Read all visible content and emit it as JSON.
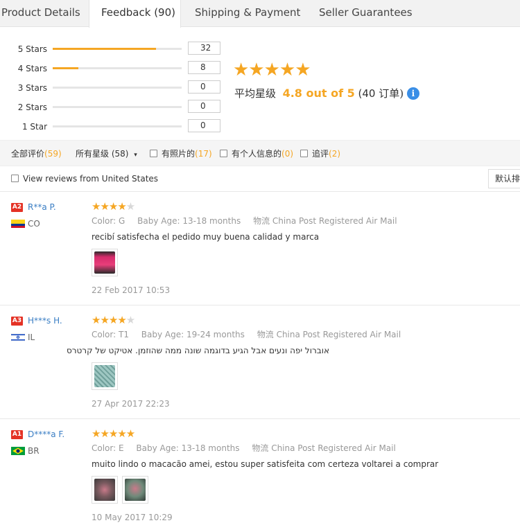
{
  "tabs": [
    {
      "label": "Product Details"
    },
    {
      "label": "Feedback (90)"
    },
    {
      "label": "Shipping & Payment"
    },
    {
      "label": "Seller Guarantees"
    }
  ],
  "rating_breakdown": [
    {
      "label": "5 Stars",
      "count": "32",
      "fill": 0.8
    },
    {
      "label": "4 Stars",
      "count": "8",
      "fill": 0.2
    },
    {
      "label": "3 Stars",
      "count": "0",
      "fill": 0
    },
    {
      "label": "2 Stars",
      "count": "0",
      "fill": 0
    },
    {
      "label": "1 Star",
      "count": "0",
      "fill": 0
    }
  ],
  "summary": {
    "stars": "★★★★★",
    "avg_prefix": "平均星级",
    "avg_score": "4.8 out of 5",
    "orders_open": "(40",
    "orders_label": "订单)",
    "info_glyph": "i",
    "accent_color": "#f5a623"
  },
  "filters": {
    "all_label": "全部评价",
    "all_count": "(59)",
    "stars_select": "所有星级 (58)",
    "photos_label": "有照片的",
    "photos_count": "(17)",
    "personal_label": "有个人信息的",
    "personal_count": "(0)",
    "followup_label": "追评",
    "followup_count": "(2)"
  },
  "us_filter": {
    "label": "View reviews from United States"
  },
  "sort_button": {
    "label": "默认排序"
  },
  "reviews": [
    {
      "level": "A2",
      "name": "R**a P.",
      "country": "CO",
      "stars": "★★★★",
      "stars_off": "★",
      "color_key": "Color:",
      "color_val": "G",
      "age_key": "Baby Age:",
      "age_val": "13-18 months",
      "ship_key": "物流",
      "ship_val": "China Post Registered Air Mail",
      "text": "recibí satisfecha el pedido muy buena calidad y marca",
      "date": "22 Feb 2017 10:53"
    },
    {
      "level": "A3",
      "name": "H***s H.",
      "country": "IL",
      "stars": "★★★★",
      "stars_off": "★",
      "color_key": "Color:",
      "color_val": "T1",
      "age_key": "Baby Age:",
      "age_val": "19-24 months",
      "ship_key": "物流",
      "ship_val": "China Post Registered Air Mail",
      "text": "אוברול יפה ונעים אבל הגיע בדוגמה שונה ממה שהוזמן. אטיקט של קרטרס",
      "date": "27 Apr 2017 22:23"
    },
    {
      "level": "A1",
      "name": "D****a F.",
      "country": "BR",
      "stars": "★★★★★",
      "stars_off": "",
      "color_key": "Color:",
      "color_val": "E",
      "age_key": "Baby Age:",
      "age_val": "13-18 months",
      "ship_key": "物流",
      "ship_val": "China Post Registered Air Mail",
      "text": "muito lindo o macacão amei, estou super satisfeita com certeza voltarei a comprar",
      "date": "10 May 2017 10:29"
    }
  ]
}
